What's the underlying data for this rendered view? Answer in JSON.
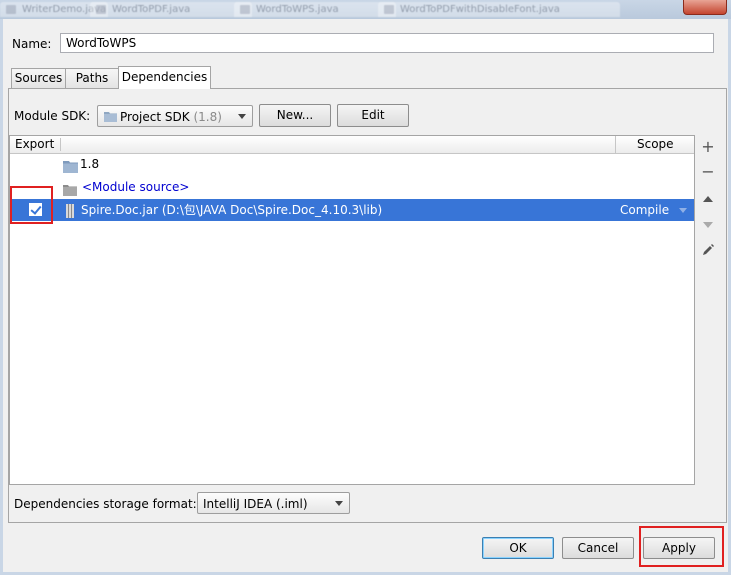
{
  "window": {
    "background_tabs": [
      "WriterDemo.java",
      "WordToPDF.java",
      "WordToWPS.java",
      "WordToPDFwithDisableFont.java"
    ]
  },
  "name_field": {
    "label": "Name:",
    "value": "WordToWPS"
  },
  "tabs": [
    {
      "label": "Sources",
      "active": false
    },
    {
      "label": "Paths",
      "active": false
    },
    {
      "label": "Dependencies",
      "active": true
    }
  ],
  "module_sdk": {
    "label": "Module SDK:",
    "selected_name": "Project SDK",
    "selected_version": "(1.8)",
    "new_button": "New...",
    "edit_button": "Edit"
  },
  "table": {
    "headers": {
      "export": "Export",
      "scope": "Scope"
    },
    "rows": [
      {
        "icon": "folder-icon",
        "text": "1.8",
        "scope": ""
      },
      {
        "icon": "folder-icon",
        "text": "<Module source>",
        "scope": ""
      },
      {
        "icon": "jar-icon",
        "text": "Spire.Doc.jar (D:\\包\\JAVA Doc\\Spire.Doc_4.10.3\\lib)",
        "scope": "Compile",
        "exported": true,
        "selected": true
      }
    ]
  },
  "side_toolbar": [
    "add-icon",
    "remove-icon",
    "move-up-icon",
    "move-down-icon",
    "edit-icon"
  ],
  "storage_format": {
    "label": "Dependencies storage format:",
    "selected": "IntelliJ IDEA (.iml)"
  },
  "footer": {
    "ok": "OK",
    "cancel": "Cancel",
    "apply": "Apply"
  },
  "colors": {
    "selection": "#3875d7",
    "highlight": "#e02020",
    "link": "#0000d0"
  }
}
